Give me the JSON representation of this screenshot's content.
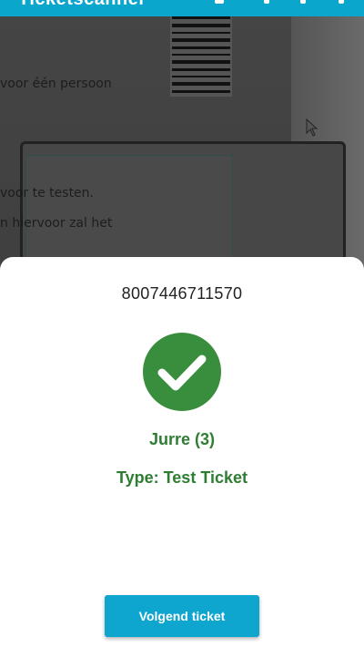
{
  "app_bar": {
    "title": "Ticketscanner"
  },
  "camera": {
    "text_lines": [
      "voor één persoon",
      "voor te testen.",
      "n hiervoor zal het"
    ]
  },
  "result": {
    "ticket_code": "8007446711570",
    "status_icon": "check-circle-icon",
    "name": "Jurre (3)",
    "type": "Type: Test Ticket",
    "success_color": "#2e7d32"
  },
  "actions": {
    "next_label": "Volgend ticket"
  },
  "colors": {
    "accent": "#0aa6cc",
    "button": "#0ea5cf"
  }
}
